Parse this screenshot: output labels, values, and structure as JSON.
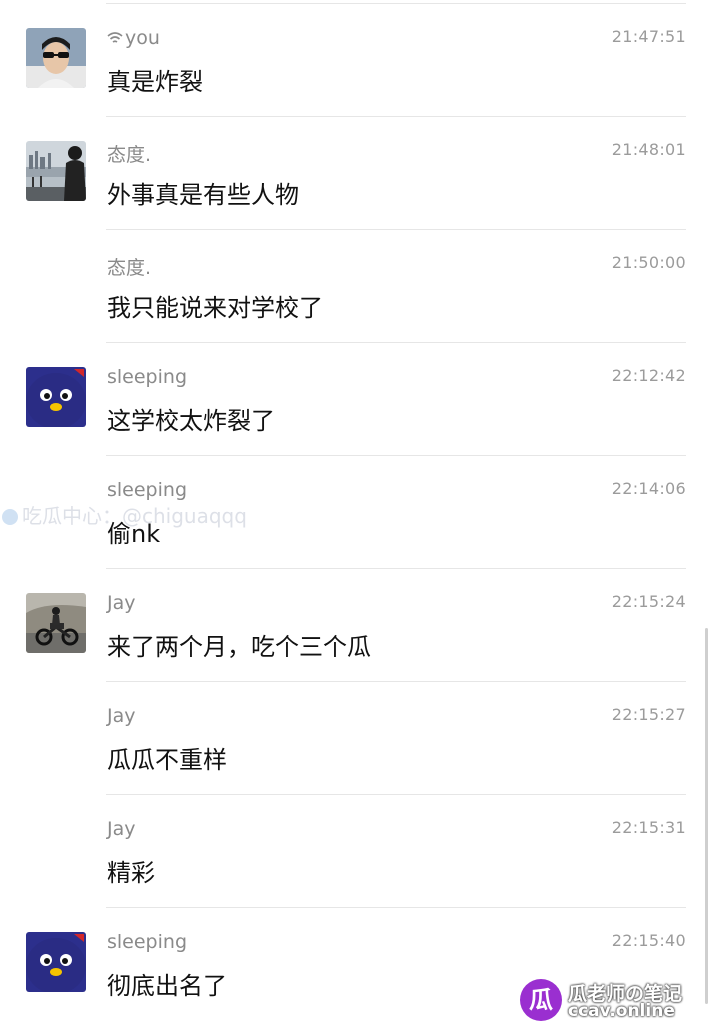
{
  "messages": [
    {
      "sender": "you",
      "time": "21:47:51",
      "text": "真是炸裂",
      "avatar": "selfie-sunglasses",
      "sender_icon": "wifi-icon"
    },
    {
      "sender": "态度.",
      "time": "21:48:01",
      "text": "外事真是有些人物",
      "avatar": "city-skyline"
    },
    {
      "sender": "态度.",
      "time": "21:50:00",
      "text": "我只能说来对学校了",
      "avatar": ""
    },
    {
      "sender": "sleeping",
      "time": "22:12:42",
      "text": "这学校太炸裂了",
      "avatar": "blue-penguin"
    },
    {
      "sender": "sleeping",
      "time": "22:14:06",
      "text": "偷nk",
      "avatar": ""
    },
    {
      "sender": "Jay",
      "time": "22:15:24",
      "text": "来了两个月，吃个三个瓜",
      "avatar": "motorcycle-rider"
    },
    {
      "sender": "Jay",
      "time": "22:15:27",
      "text": "瓜瓜不重样",
      "avatar": ""
    },
    {
      "sender": "Jay",
      "time": "22:15:31",
      "text": "精彩",
      "avatar": ""
    },
    {
      "sender": "sleeping",
      "time": "22:15:40",
      "text": "彻底出名了",
      "avatar": "blue-penguin"
    }
  ],
  "watermarks": {
    "telegram": "吃瓜中心：@chiguaqqq",
    "badge_glyph": "瓜",
    "badge_line1": "瓜老师の笔记",
    "badge_line2": "ccav.online"
  },
  "colors": {
    "sender": "#8a8a8a",
    "time": "#9b9b9b",
    "content": "#111111",
    "divider": "#e6e6e6",
    "badge": "#9a2fd0"
  }
}
